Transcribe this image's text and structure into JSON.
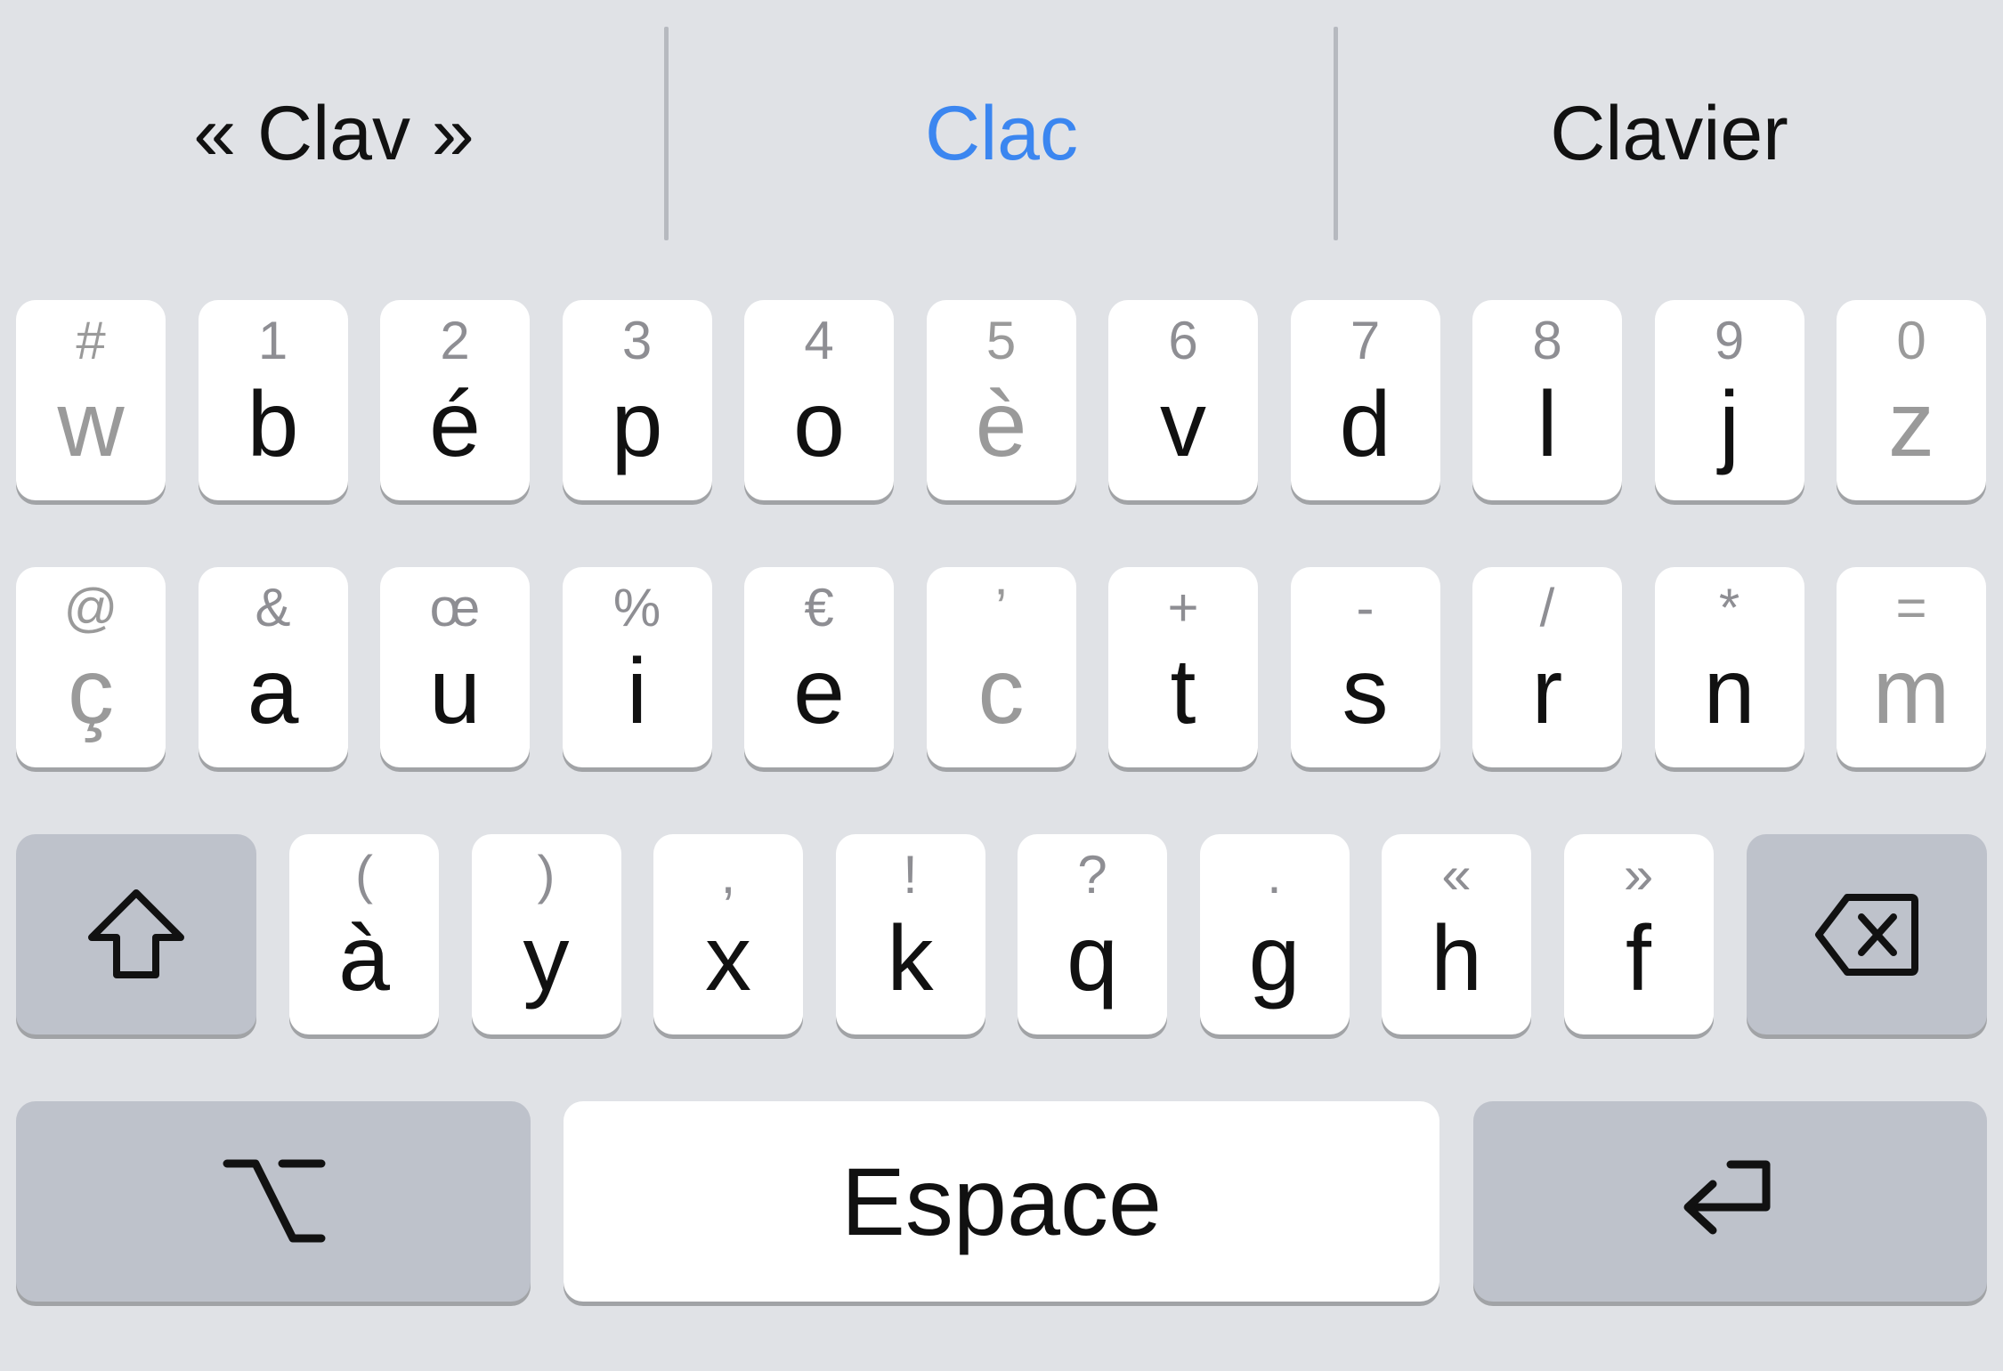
{
  "suggestions": {
    "left": "« Clav »",
    "center": "Clac",
    "right": "Clavier"
  },
  "colors": {
    "background": "#e0e2e6",
    "key": "#ffffff",
    "special_key": "#bec2cb",
    "suggestion_highlight": "#3b86f0",
    "dimmed_glyph": "#9a9a9a"
  },
  "rows": [
    {
      "keys": [
        {
          "primary": "w",
          "secondary": "#",
          "dimmed": true
        },
        {
          "primary": "b",
          "secondary": "1",
          "dimmed": false
        },
        {
          "primary": "é",
          "secondary": "2",
          "dimmed": false
        },
        {
          "primary": "p",
          "secondary": "3",
          "dimmed": false
        },
        {
          "primary": "o",
          "secondary": "4",
          "dimmed": false
        },
        {
          "primary": "è",
          "secondary": "5",
          "dimmed": true
        },
        {
          "primary": "v",
          "secondary": "6",
          "dimmed": false
        },
        {
          "primary": "d",
          "secondary": "7",
          "dimmed": false
        },
        {
          "primary": "l",
          "secondary": "8",
          "dimmed": false
        },
        {
          "primary": "j",
          "secondary": "9",
          "dimmed": false
        },
        {
          "primary": "z",
          "secondary": "0",
          "dimmed": true
        }
      ]
    },
    {
      "keys": [
        {
          "primary": "ç",
          "secondary": "@",
          "dimmed": true
        },
        {
          "primary": "a",
          "secondary": "&",
          "dimmed": false
        },
        {
          "primary": "u",
          "secondary": "œ",
          "dimmed": false
        },
        {
          "primary": "i",
          "secondary": "%",
          "dimmed": false
        },
        {
          "primary": "e",
          "secondary": "€",
          "dimmed": false
        },
        {
          "primary": "c",
          "secondary": "’",
          "dimmed": true
        },
        {
          "primary": "t",
          "secondary": "+",
          "dimmed": false
        },
        {
          "primary": "s",
          "secondary": "-",
          "dimmed": false
        },
        {
          "primary": "r",
          "secondary": "/",
          "dimmed": false
        },
        {
          "primary": "n",
          "secondary": "*",
          "dimmed": false
        },
        {
          "primary": "m",
          "secondary": "=",
          "dimmed": true
        }
      ]
    },
    {
      "keys": [
        {
          "primary": "à",
          "secondary": "(",
          "dimmed": false
        },
        {
          "primary": "y",
          "secondary": ")",
          "dimmed": false
        },
        {
          "primary": "x",
          "secondary": ",",
          "dimmed": false
        },
        {
          "primary": "k",
          "secondary": "!",
          "dimmed": false
        },
        {
          "primary": "q",
          "secondary": "?",
          "dimmed": false
        },
        {
          "primary": "g",
          "secondary": ".",
          "dimmed": false
        },
        {
          "primary": "h",
          "secondary": "«",
          "dimmed": false
        },
        {
          "primary": "f",
          "secondary": "»",
          "dimmed": false
        }
      ]
    }
  ],
  "bottom": {
    "space_label": "Espace"
  },
  "icons": {
    "shift": "shift-arrow-icon",
    "delete": "backspace-icon",
    "option": "option-key-icon",
    "return": "return-arrow-icon"
  }
}
